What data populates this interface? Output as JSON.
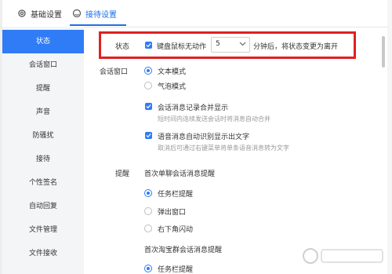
{
  "tabs": [
    {
      "label": "基础设置",
      "icon": "gear-icon"
    },
    {
      "label": "接待设置",
      "icon": "headset-icon"
    }
  ],
  "sidebar": {
    "items": [
      {
        "label": "状态"
      },
      {
        "label": "会话窗口"
      },
      {
        "label": "提醒"
      },
      {
        "label": "声音"
      },
      {
        "label": "防骚扰"
      },
      {
        "label": "接待"
      },
      {
        "label": "个性签名"
      },
      {
        "label": "自动回复"
      },
      {
        "label": "文件管理"
      },
      {
        "label": "文件接收"
      }
    ]
  },
  "status": {
    "label": "状态",
    "checkbox_label": "键盘鼠标无动作",
    "minutes_value": "5",
    "suffix": "分钟后，将状态变更为离开"
  },
  "session_window": {
    "label": "会话窗口",
    "mode_text": "文本模式",
    "mode_bubble": "气泡模式",
    "merge_label": "会话消息记录合并显示",
    "merge_hint": "短时间内连续发送会话时将消息自动合并",
    "voice_label": "语音消息自动识别显示出文字",
    "voice_hint": "取消后可通过右键菜单将单条语音消息转为文字"
  },
  "reminder": {
    "label": "提醒",
    "first_single_title": "首次单聊会话消息提醒",
    "option_taskbar": "任务栏提醒",
    "option_popup": "弹出窗口",
    "option_corner": "右下角闪动",
    "first_group_title": "首次淘宝群会话消息提醒",
    "option_taskbar_2": "任务栏提醒"
  },
  "colors": {
    "accent": "#2f7cf6",
    "highlight_box": "#e02020"
  }
}
